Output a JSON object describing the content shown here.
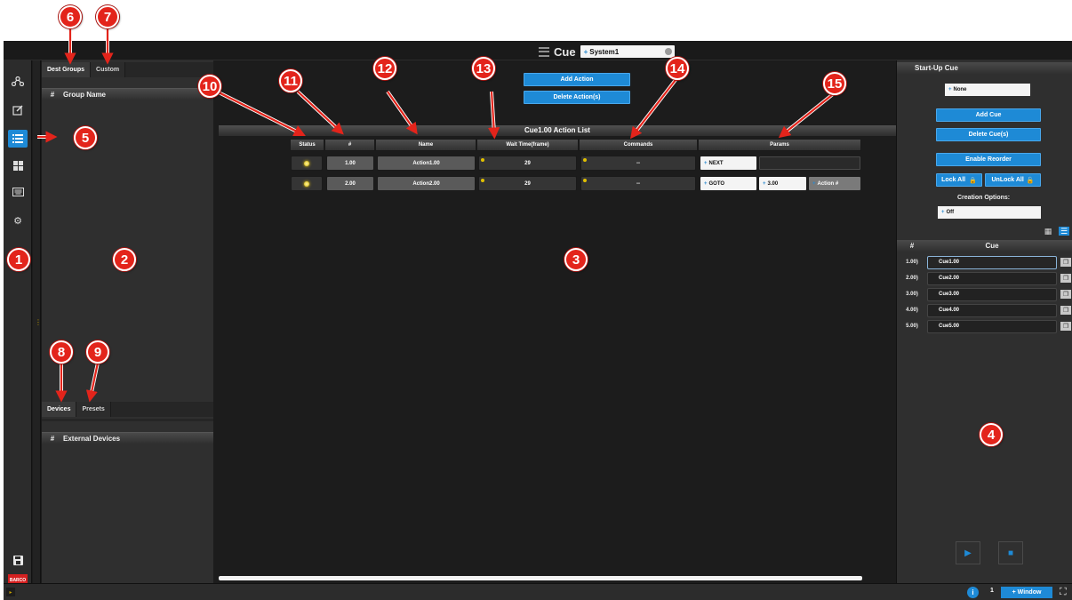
{
  "titlebar": {
    "title": "Cue",
    "system_select": "System1"
  },
  "toolbar": {
    "icons": [
      "network-icon",
      "edit-icon",
      "list-icon",
      "grid-icon",
      "keyboard-icon",
      "gear-icon"
    ],
    "active_index": 2,
    "brand": "BARCO"
  },
  "left_panel": {
    "top_tabs": [
      "Dest Groups",
      "Custom"
    ],
    "group_header": {
      "hash": "#",
      "label": "Group Name"
    },
    "bottom_tabs": [
      "Devices",
      "Presets"
    ],
    "devices_header": {
      "hash": "#",
      "label": "External Devices"
    }
  },
  "main": {
    "add_action": "Add Action",
    "delete_action": "Delete Action(s)",
    "list_title": "Cue1.00 Action List",
    "columns": [
      "Status",
      "#",
      "Name",
      "Wait Time(frame)",
      "Commands",
      "Params"
    ],
    "rows": [
      {
        "num": "1.00",
        "name": "Action1.00",
        "wait": "29",
        "command": "--",
        "params": [
          "NEXT"
        ]
      },
      {
        "num": "2.00",
        "name": "Action2.00",
        "wait": "29",
        "command": "--",
        "params": [
          "GOTO",
          "3.00",
          "Action #"
        ]
      }
    ]
  },
  "right_panel": {
    "startup_header": "Start-Up Cue",
    "startup_select": "None",
    "add_cue": "Add Cue",
    "delete_cue": "Delete Cue(s)",
    "enable_reorder": "Enable Reorder",
    "lock_all": "Lock All",
    "unlock_all": "UnLock All",
    "creation_label": "Creation Options:",
    "creation_select": "Off",
    "cue_header": {
      "hash": "#",
      "label": "Cue"
    },
    "cues": [
      {
        "num": "1.00)",
        "name": "Cue1.00"
      },
      {
        "num": "2.00)",
        "name": "Cue2.00"
      },
      {
        "num": "3.00)",
        "name": "Cue3.00"
      },
      {
        "num": "4.00)",
        "name": "Cue4.00"
      },
      {
        "num": "5.00)",
        "name": "Cue5.00"
      }
    ]
  },
  "statusbar": {
    "info": "i",
    "page": "1",
    "window": "Window"
  },
  "callouts": [
    "1",
    "2",
    "3",
    "4",
    "5",
    "6",
    "7",
    "8",
    "9",
    "10",
    "11",
    "12",
    "13",
    "14",
    "15"
  ],
  "colors": {
    "accent": "#1e8ad6",
    "callout": "#e3241b",
    "led": "#f5d200",
    "background": "#1c1c1c"
  }
}
